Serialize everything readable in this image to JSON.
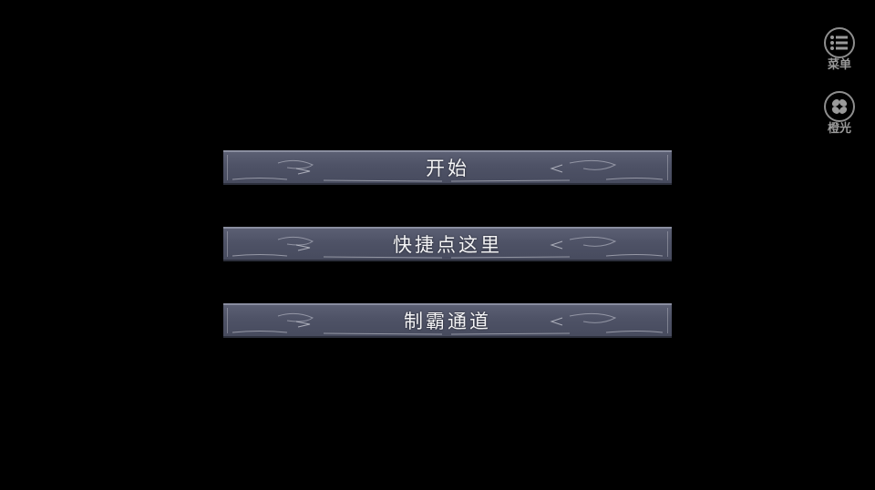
{
  "menu": {
    "items": [
      {
        "label": "开始"
      },
      {
        "label": "快捷点这里"
      },
      {
        "label": "制霸通道"
      }
    ]
  },
  "side_tools": {
    "menu": {
      "label": "菜单",
      "icon": "list-icon"
    },
    "orange": {
      "label": "橙光",
      "icon": "orange-logo-icon"
    }
  },
  "colors": {
    "background": "#000000",
    "bar_fill": "#4e5266",
    "bar_text": "#f4f4f6",
    "tool_gray": "#9a9a9a"
  }
}
